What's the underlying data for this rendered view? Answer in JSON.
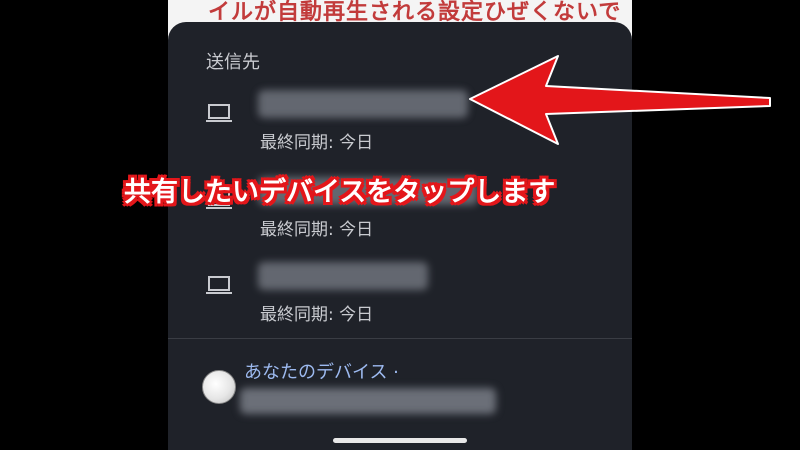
{
  "background_page": {
    "text": "イルが自動再生される設定ひぜくないで"
  },
  "share_sheet": {
    "title": "送信先",
    "devices": [
      {
        "name": "",
        "sync": "最終同期: 今日",
        "icon": "laptop-icon"
      },
      {
        "name": "",
        "sync": "最終同期: 今日",
        "icon": "laptop-icon"
      },
      {
        "name": "",
        "sync": "最終同期: 今日",
        "icon": "laptop-icon"
      }
    ],
    "account": {
      "label": "あなたのデバイス ·",
      "email": ""
    }
  },
  "annotation": {
    "caption": "共有したいデバイスをタップします",
    "arrow_color": "#e3161a"
  },
  "colors": {
    "sheet_bg": "#1f2229",
    "text": "#c9cbd0",
    "link": "#9dbaf0"
  }
}
